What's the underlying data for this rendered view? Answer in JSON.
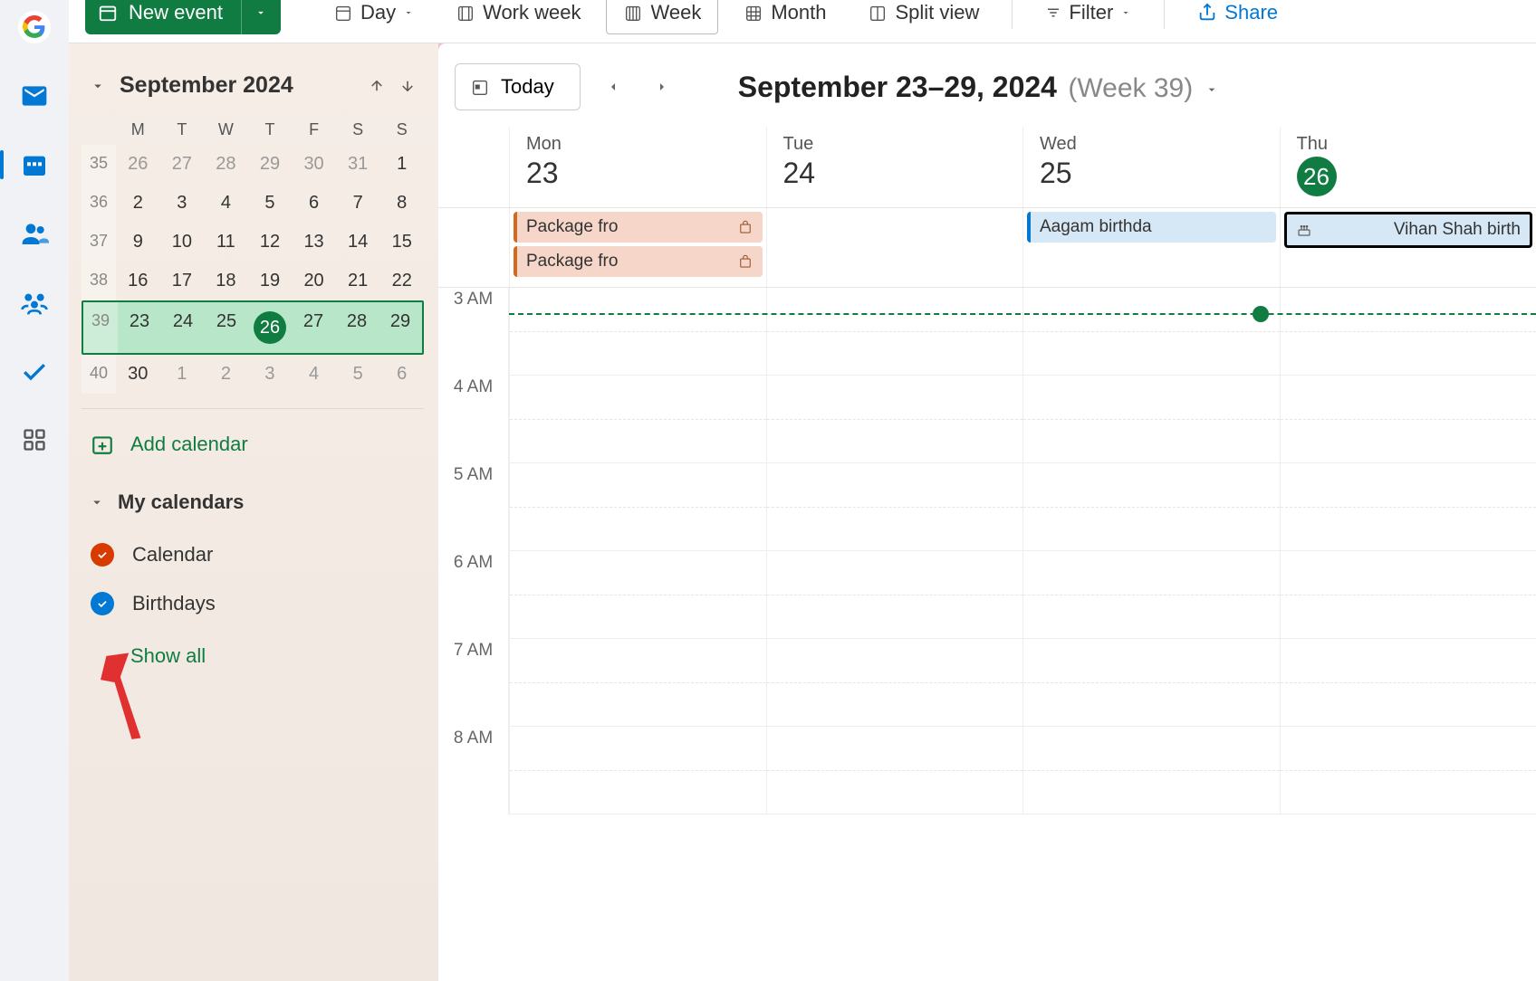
{
  "toolbar": {
    "new_event": "New event",
    "views": {
      "day": "Day",
      "work_week": "Work week",
      "week": "Week",
      "month": "Month",
      "split": "Split view"
    },
    "filter": "Filter",
    "share": "Share"
  },
  "mini_calendar": {
    "title": "September 2024",
    "day_labels": [
      "M",
      "T",
      "W",
      "T",
      "F",
      "S",
      "S"
    ],
    "weeks": [
      {
        "wk": "35",
        "days": [
          "26",
          "27",
          "28",
          "29",
          "30",
          "31",
          "1"
        ],
        "dim": [
          0,
          1,
          2,
          3,
          4,
          5
        ]
      },
      {
        "wk": "36",
        "days": [
          "2",
          "3",
          "4",
          "5",
          "6",
          "7",
          "8"
        ]
      },
      {
        "wk": "37",
        "days": [
          "9",
          "10",
          "11",
          "12",
          "13",
          "14",
          "15"
        ]
      },
      {
        "wk": "38",
        "days": [
          "16",
          "17",
          "18",
          "19",
          "20",
          "21",
          "22"
        ]
      },
      {
        "wk": "39",
        "days": [
          "23",
          "24",
          "25",
          "26",
          "27",
          "28",
          "29"
        ],
        "selected": true,
        "today_idx": 3
      },
      {
        "wk": "40",
        "days": [
          "30",
          "1",
          "2",
          "3",
          "4",
          "5",
          "6"
        ],
        "dim": [
          1,
          2,
          3,
          4,
          5,
          6
        ]
      }
    ]
  },
  "sidebar": {
    "add_calendar": "Add calendar",
    "my_calendars": "My calendars",
    "calendars": [
      {
        "name": "Calendar",
        "color": "#d83b01"
      },
      {
        "name": "Birthdays",
        "color": "#0078d4"
      }
    ],
    "show_all": "Show all"
  },
  "main": {
    "today": "Today",
    "title_range": "September 23–29, 2024",
    "title_week": "(Week 39)",
    "days": [
      {
        "label": "Mon",
        "num": "23"
      },
      {
        "label": "Tue",
        "num": "24"
      },
      {
        "label": "Wed",
        "num": "25"
      },
      {
        "label": "Thu",
        "num": "26",
        "today": true
      }
    ],
    "allday_events": {
      "mon": [
        {
          "title": "Package fro",
          "kind": "package"
        },
        {
          "title": "Package fro",
          "kind": "package"
        }
      ],
      "wed": [
        {
          "title": "Aagam birthda",
          "kind": "blue"
        }
      ],
      "thu": [
        {
          "title": "Vihan Shah birth",
          "kind": "birthday",
          "selected": true
        }
      ]
    },
    "time_labels": [
      "3 AM",
      "4 AM",
      "5 AM",
      "6 AM",
      "7 AM",
      "8 AM"
    ]
  }
}
